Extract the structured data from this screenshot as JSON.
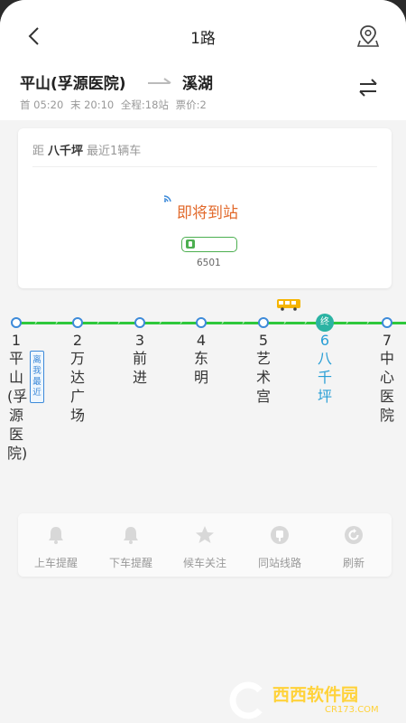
{
  "header": {
    "title": "1路",
    "back_icon": "chevron-left-icon",
    "map_icon": "map-pin-icon"
  },
  "route": {
    "from": "平山(孚源医院)",
    "to": "溪湖",
    "swap_icon": "swap-arrows-icon",
    "first": "首 05:20",
    "last": "末 20:10",
    "total": "全程:18站",
    "fare": "票价:2"
  },
  "arrival_card": {
    "prefix": "距",
    "station": "八千坪",
    "suffix": "最近1辆车",
    "status": "即将到站",
    "bus_plate": "6501"
  },
  "line": {
    "color": "#2fc83c",
    "stops": [
      {
        "num": "1",
        "name": "平山(孚源医院)"
      },
      {
        "num": "2",
        "name": "万达广场"
      },
      {
        "num": "3",
        "name": "前进"
      },
      {
        "num": "4",
        "name": "东明"
      },
      {
        "num": "5",
        "name": "艺术宫"
      },
      {
        "num": "6",
        "name": "八千坪"
      },
      {
        "num": "7",
        "name": "中心医院"
      }
    ],
    "near_tag": "离我最近",
    "active_badge": "终"
  },
  "toolbar": {
    "items": [
      {
        "label": "上车提醒",
        "icon": "bell-icon"
      },
      {
        "label": "下车提醒",
        "icon": "bell-icon"
      },
      {
        "label": "候车关注",
        "icon": "star-icon"
      },
      {
        "label": "同站线路",
        "icon": "bus-stop-icon"
      },
      {
        "label": "刷新",
        "icon": "refresh-icon"
      }
    ]
  },
  "watermark": {
    "brand": "西西软件园",
    "domain": "CR173.COM"
  }
}
